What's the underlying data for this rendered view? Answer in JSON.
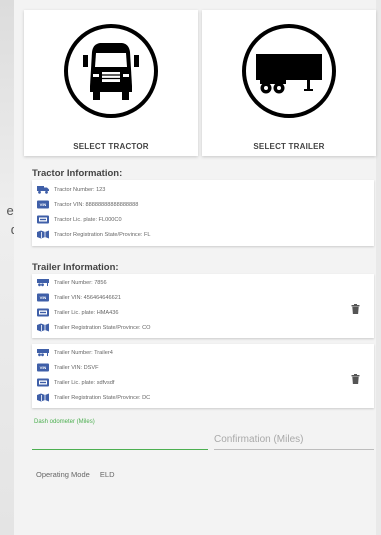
{
  "background": {
    "fragment_1": "er",
    "fragment_2": "d"
  },
  "select": {
    "tractor_label": "SELECT TRACTOR",
    "trailer_label": "SELECT TRAILER",
    "tractor_icon": "truck-front-icon",
    "trailer_icon": "trailer-icon"
  },
  "tractor": {
    "title": "Tractor Information:",
    "rows": [
      {
        "icon": "truck-icon",
        "text": "Tractor Number: 123"
      },
      {
        "icon": "vin-icon",
        "text": "Tractor VIN: 88888888888888888"
      },
      {
        "icon": "license-plate-icon",
        "text": "Tractor Lic. plate: FL000C0"
      },
      {
        "icon": "registration-icon",
        "text": "Tractor Registration State/Province: FL"
      }
    ]
  },
  "trailer": {
    "title": "Trailer Information:",
    "items": [
      {
        "rows": [
          {
            "icon": "trailer-icon",
            "text": "Trailer Number: 7856"
          },
          {
            "icon": "vin-icon",
            "text": "Trailer VIN: 456464646621"
          },
          {
            "icon": "license-plate-icon",
            "text": "Trailer Lic. plate: HMA436"
          },
          {
            "icon": "registration-icon",
            "text": "Trailer Registration State/Province: CO"
          }
        ]
      },
      {
        "rows": [
          {
            "icon": "trailer-icon",
            "text": "Trailer Number: Trailer4"
          },
          {
            "icon": "vin-icon",
            "text": "Trailer VIN: DSVF"
          },
          {
            "icon": "license-plate-icon",
            "text": "Trailer Lic. plate: sdfvsdf"
          },
          {
            "icon": "registration-icon",
            "text": "Trailer Registration State/Province: DC"
          }
        ]
      }
    ]
  },
  "odometer": {
    "label": "Dash odometer (Miles)",
    "value": "",
    "confirm_placeholder": "Confirmation (Miles)"
  },
  "operating_mode": {
    "label": "Operating Mode",
    "value": "ELD"
  },
  "colors": {
    "accent_green": "#4caf50",
    "icon_blue": "#3f5fa8",
    "card_bg": "#ffffff",
    "panel_bg": "#f3f3f3"
  }
}
